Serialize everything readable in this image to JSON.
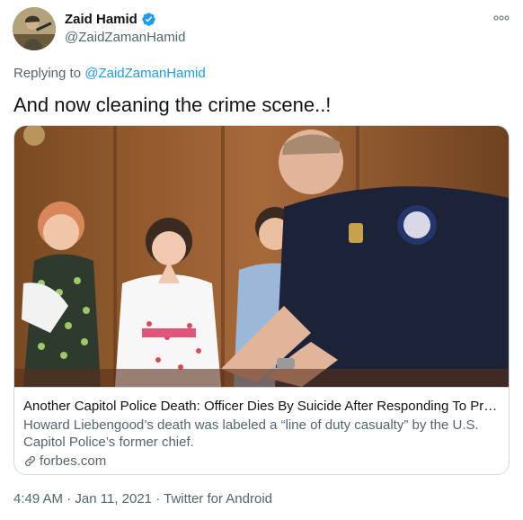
{
  "author": {
    "name": "Zaid Hamid",
    "handle": "@ZaidZamanHamid",
    "verified_icon": "verified-badge-icon",
    "avatar_icon": "avatar-photo"
  },
  "more_icon": "more-options-icon",
  "reply": {
    "prefix": "Replying to",
    "mention": "@ZaidZamanHamid"
  },
  "tweet_text": "And now cleaning the crime scene..!",
  "card": {
    "image_alt": "police-officer-fingerprinting-children-photo",
    "title": "Another Capitol Police Death: Officer Dies By Suicide After Responding To Pro-T…",
    "description": "Howard Liebengood’s death was labeled a “line of duty casualty” by the U.S. Capitol Police’s former chief.",
    "domain": "forbes.com",
    "link_icon": "link-icon"
  },
  "meta": {
    "time": "4:49 AM",
    "separator1": "·",
    "date": "Jan 11, 2021",
    "separator2": "·",
    "source": "Twitter for Android"
  },
  "colors": {
    "accent": "#1d9bf0",
    "secondary_text": "#536471",
    "border": "#cfd9de"
  }
}
